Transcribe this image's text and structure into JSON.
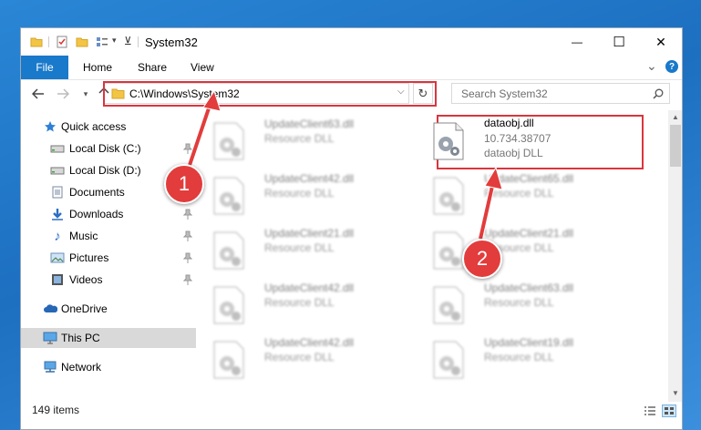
{
  "window": {
    "title": "System32",
    "minimize_glyph": "—",
    "maximize_glyph": "☐",
    "close_glyph": "✕"
  },
  "ribbon": {
    "tabs": [
      {
        "label": "File"
      },
      {
        "label": "Home"
      },
      {
        "label": "Share"
      },
      {
        "label": "View"
      }
    ],
    "expand_glyph": "⌄",
    "help_glyph": "?"
  },
  "address": {
    "path": "C:\\Windows\\System32",
    "search_placeholder": "Search System32"
  },
  "nav": {
    "items": [
      {
        "label": "Quick access",
        "icon": "star-icon"
      },
      {
        "label": "Local Disk (C:)",
        "icon": "drive-icon",
        "pinned": true
      },
      {
        "label": "Local Disk (D:)",
        "icon": "drive-icon",
        "pinned": true
      },
      {
        "label": "Documents",
        "icon": "documents-icon",
        "pinned": true
      },
      {
        "label": "Downloads",
        "icon": "downloads-icon",
        "pinned": true
      },
      {
        "label": "Music",
        "icon": "music-icon",
        "pinned": true
      },
      {
        "label": "Pictures",
        "icon": "pictures-icon",
        "pinned": true
      },
      {
        "label": "Videos",
        "icon": "videos-icon",
        "pinned": true
      },
      {
        "label": "OneDrive",
        "icon": "cloud-icon"
      },
      {
        "label": "This PC",
        "icon": "computer-icon",
        "selected": true
      },
      {
        "label": "Network",
        "icon": "network-icon"
      }
    ]
  },
  "files": {
    "left_column": [
      {
        "name": "UpdateClient63.dll",
        "desc": "Resource DLL"
      },
      {
        "name": "UpdateClient42.dll",
        "desc": "Resource DLL"
      },
      {
        "name": "UpdateClient21.dll",
        "desc": "Resource DLL"
      },
      {
        "name": "UpdateClient42.dll",
        "desc": "Resource DLL"
      },
      {
        "name": "UpdateClient42.dll",
        "desc": "Resource DLL"
      }
    ],
    "right_column": [
      {
        "name": "dataobj.dll",
        "version": "10.734.38707",
        "desc": "dataobj DLL"
      },
      {
        "name": "UpdateClient65.dll",
        "desc": "Resource DLL"
      },
      {
        "name": "UpdateClient21.dll",
        "desc": "Resource DLL"
      },
      {
        "name": "UpdateClient63.dll",
        "desc": "Resource DLL"
      },
      {
        "name": "UpdateClient19.dll",
        "desc": "Resource DLL"
      }
    ]
  },
  "status": {
    "item_count": "149 items"
  },
  "markers": [
    {
      "label": "1"
    },
    {
      "label": "2"
    }
  ],
  "colors": {
    "accent": "#1979ca",
    "highlight": "#d9363e",
    "marker": "#e23c3c"
  }
}
